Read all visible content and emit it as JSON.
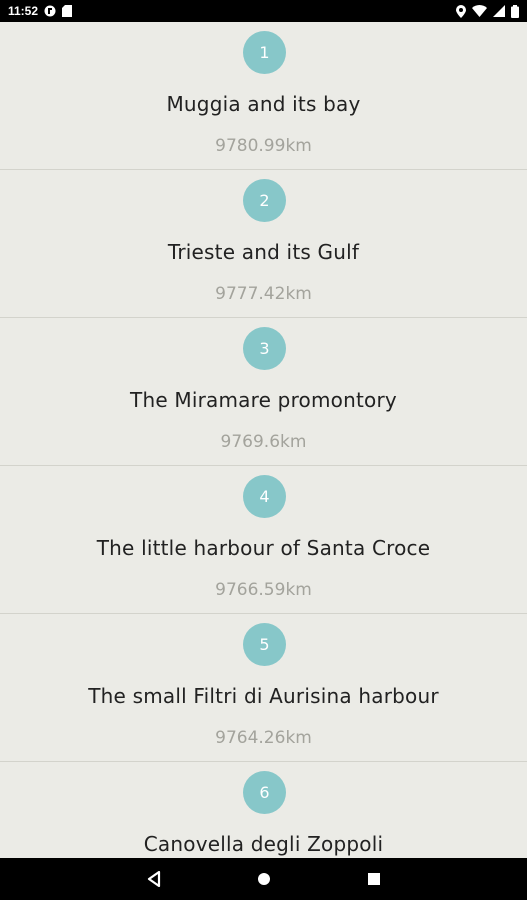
{
  "status_bar": {
    "time": "11:52",
    "icons": [
      "app-notification-icon",
      "sd-card-icon",
      "location-icon",
      "wifi-icon",
      "signal-icon",
      "battery-icon"
    ]
  },
  "items": [
    {
      "number": "1",
      "title": "Muggia and its bay",
      "distance": "9780.99km"
    },
    {
      "number": "2",
      "title": "Trieste and its Gulf",
      "distance": "9777.42km"
    },
    {
      "number": "3",
      "title": "The Miramare promontory",
      "distance": "9769.6km"
    },
    {
      "number": "4",
      "title": "The little harbour of Santa Croce",
      "distance": "9766.59km"
    },
    {
      "number": "5",
      "title": "The small Filtri di Aurisina harbour",
      "distance": "9764.26km"
    },
    {
      "number": "6",
      "title": "Canovella degli Zoppoli",
      "distance": ""
    }
  ],
  "colors": {
    "badge": "#87c7c9",
    "background": "#ebebe6",
    "distance_text": "#a3a39c",
    "divider": "#d3d3cc"
  },
  "nav_bar": {
    "buttons": [
      "back-icon",
      "home-icon",
      "recents-icon"
    ]
  }
}
